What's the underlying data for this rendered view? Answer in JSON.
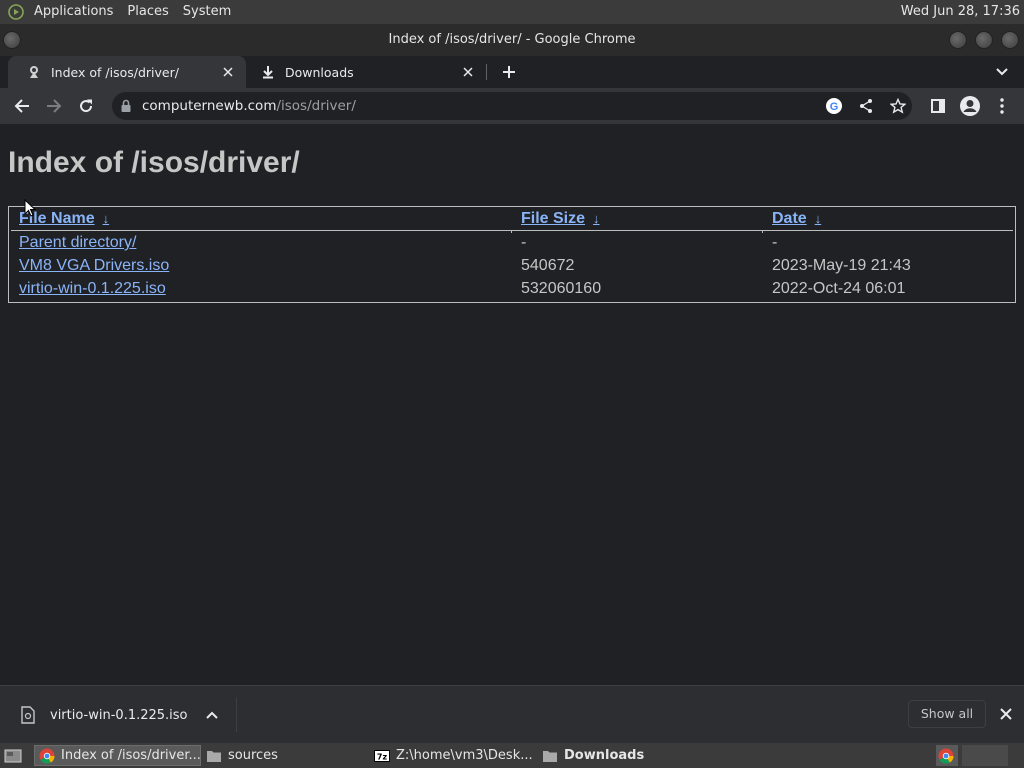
{
  "panel": {
    "menus": [
      "Applications",
      "Places",
      "System"
    ],
    "clock": "Wed Jun 28, 17:36"
  },
  "window": {
    "title": "Index of /isos/driver/ - Google Chrome"
  },
  "tabs": [
    {
      "label": "Index of /isos/driver/",
      "icon": "site-favicon-icon",
      "active": true
    },
    {
      "label": "Downloads",
      "icon": "download-icon",
      "active": false
    }
  ],
  "omnibox": {
    "host": "computernewb.com",
    "path": "/isos/driver/"
  },
  "page": {
    "heading": "Index of /isos/driver/",
    "columns": [
      {
        "label": "File Name",
        "sort": "↓"
      },
      {
        "label": "File Size",
        "sort": "↓"
      },
      {
        "label": "Date",
        "sort": "↓"
      }
    ],
    "rows": [
      {
        "name": "Parent directory/",
        "size": "-",
        "date": "-"
      },
      {
        "name": "VM8 VGA Drivers.iso",
        "size": "540672",
        "date": "2023-May-19 21:43"
      },
      {
        "name": "virtio-win-0.1.225.iso",
        "size": "532060160",
        "date": "2022-Oct-24 06:01"
      }
    ]
  },
  "download_shelf": {
    "item": "virtio-win-0.1.225.iso",
    "show_all": "Show all"
  },
  "taskbar": {
    "tasks": [
      {
        "label": "Index of /isos/driver...",
        "icon": "chrome-icon",
        "active": true
      },
      {
        "label": "sources",
        "icon": "folder-icon",
        "active": false
      },
      {
        "label": "Z:\\home\\vm3\\Desk...",
        "icon": "sevenzip-icon",
        "active": false
      },
      {
        "label": "Downloads",
        "icon": "folder-icon",
        "active": false
      }
    ]
  },
  "colors": {
    "link": "#8ab4f8",
    "page_bg": "#202124",
    "toolbar_bg": "#35363a",
    "panel_bg": "#3b3b3b"
  }
}
